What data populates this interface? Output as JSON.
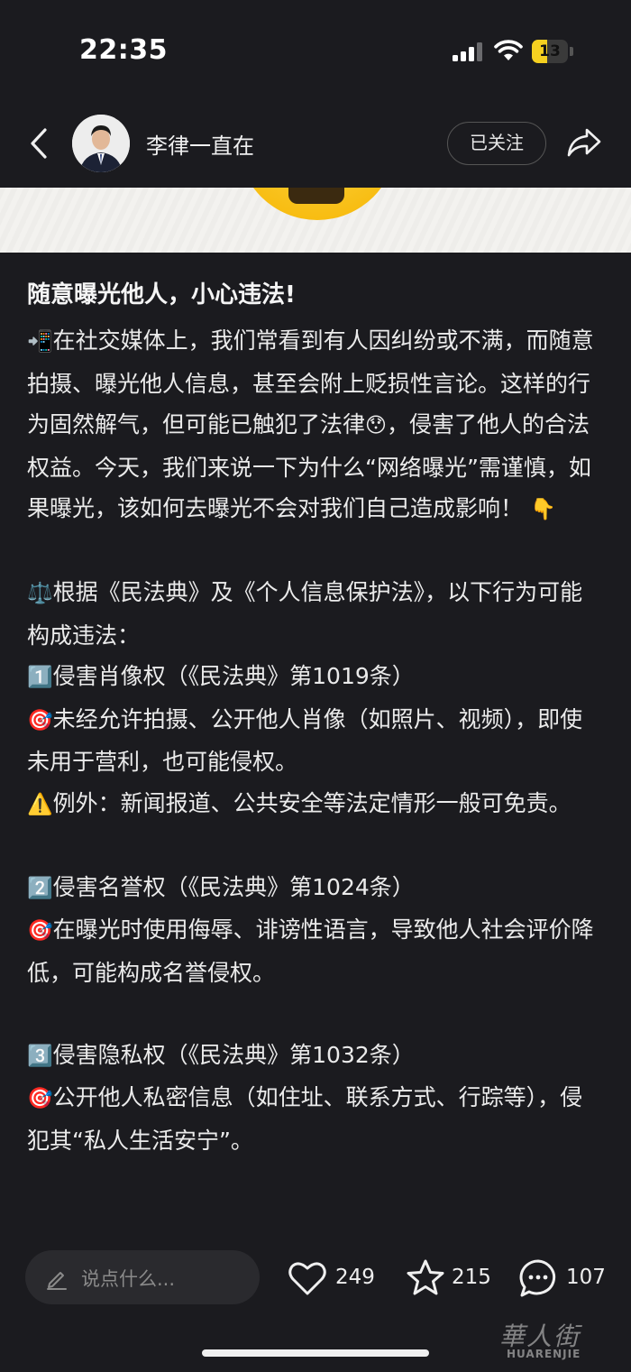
{
  "status_bar": {
    "time": "22:35",
    "battery_level": "13",
    "battery_fraction": 0.13
  },
  "nav": {
    "author_name": "李律一直在",
    "follow_label": "已关注"
  },
  "post": {
    "title": "随意曝光他人，小心违法!",
    "paragraphs": [
      {
        "emoji": "📲",
        "text": "在社交媒体上，我们常看到有人因纠纷或不满，而随意拍摄、曝光他人信息，甚至会附上贬损性言论。这样的行为固然解气，但可能已触犯了法律"
      },
      {
        "emoji": "😯",
        "text": "，侵害了他人的合法权益。今天，我们来说一下为什么“网络曝光”需谨慎，如果曝光，该如何去曝光不会对我们自己造成影响！"
      },
      {
        "emoji": "👇",
        "text": ""
      },
      {
        "emoji": "⚖️",
        "text": "根据《民法典》及《个人信息保护法》，以下行为可能构成违法："
      },
      {
        "emoji": "1️⃣",
        "text": "侵害肖像权（《民法典》第1019条）"
      },
      {
        "emoji": "🎯",
        "text": "未经允许拍摄、公开他人肖像（如照片、视频），即使未用于营利，也可能侵权。"
      },
      {
        "emoji": "⚠️",
        "text": "例外：新闻报道、公共安全等法定情形一般可免责。"
      },
      {
        "emoji": "2️⃣",
        "text": "侵害名誉权（《民法典》第1024条）"
      },
      {
        "emoji": "🎯",
        "text": "在曝光时使用侮辱、诽谤性语言，导致他人社会评价降低，可能构成名誉侵权。"
      },
      {
        "emoji": "3️⃣",
        "text": "侵害隐私权（《民法典》第1032条）"
      },
      {
        "emoji": "🎯",
        "text": "公开他人私密信息（如住址、联系方式、行踪等），侵犯其“私人生活安宁”。"
      }
    ]
  },
  "bottom_bar": {
    "comment_placeholder": "说点什么...",
    "likes": "249",
    "favorites": "215",
    "comments": "107"
  },
  "watermark": {
    "cn": "華人街",
    "en": "HUARENJIE"
  },
  "icons": {
    "back": "chevron-left-icon",
    "share": "share-arrow-icon",
    "like": "heart-icon",
    "favorite": "star-icon",
    "comment": "speech-bubble-icon",
    "pen": "pen-icon"
  },
  "colors": {
    "background": "#1b1b1f",
    "text": "#ebebeb",
    "battery": "#f5d020"
  }
}
